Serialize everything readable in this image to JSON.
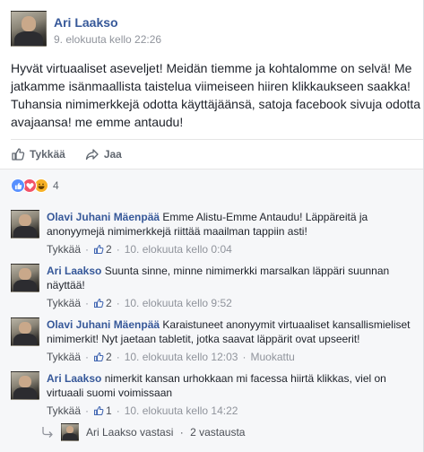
{
  "post": {
    "author": "Ari Laakso",
    "time": "9. elokuuta kello 22:26",
    "body": "Hyvät virtuaaliset aseveljet! Meidän tiemme ja kohtalomme on selvä! Me\njatkamme isänmaallista taistelua viimeiseen hiiren klikkaukseen saakka!\nTuhansia nimimerkkejä odotta käyttäjäänsä, satoja facebook sivuja odotta\navajaansa! me emme antaudu!"
  },
  "actions": {
    "like": "Tykkää",
    "share": "Jaa",
    "like_icon": "thumbs-up-icon",
    "share_icon": "share-arrow-icon"
  },
  "reactions": {
    "types": [
      "like",
      "love",
      "haha"
    ],
    "count": "4",
    "colors": {
      "like": "#5890ff",
      "love": "#f25268",
      "haha": "#f7b125"
    }
  },
  "comments": [
    {
      "author": "Olavi Juhani Mäenpää",
      "text": "Emme Alistu-Emme Antaudu! Läppäreitä ja anonyymejä nimimerkkejä riittää maailman tappiin asti!",
      "like_label": "Tykkää",
      "likes": "2",
      "time": "10. elokuuta kello 0:04",
      "edited": ""
    },
    {
      "author": "Ari Laakso",
      "text": "Suunta sinne, minne nimimerkki marsalkan läppäri suunnan näyttää!",
      "like_label": "Tykkää",
      "likes": "2",
      "time": "10. elokuuta kello 9:52",
      "edited": ""
    },
    {
      "author": "Olavi Juhani Mäenpää",
      "text": "Karaistuneet anonyymit virtuaaliset kansallismieliset nimimerkit! Nyt jaetaan tabletit, jotka saavat läppärit ovat upseerit!",
      "like_label": "Tykkää",
      "likes": "2",
      "time": "10. elokuuta kello 12:03",
      "edited": "Muokattu"
    },
    {
      "author": "Ari Laakso",
      "text": "nimerkit kansan urhokkaan mi facessa hiirtä klikkas, viel on virtuaali suomi voimissaan",
      "like_label": "Tykkää",
      "likes": "1",
      "time": "10. elokuuta kello 14:22",
      "edited": ""
    }
  ],
  "replies": {
    "author": "Ari Laakso",
    "verb": "vastasi",
    "count": "2 vastausta"
  },
  "colors": {
    "link": "#365899",
    "meta": "#90949c",
    "background": "#f6f7f9",
    "like_blue": "#4267b2"
  }
}
